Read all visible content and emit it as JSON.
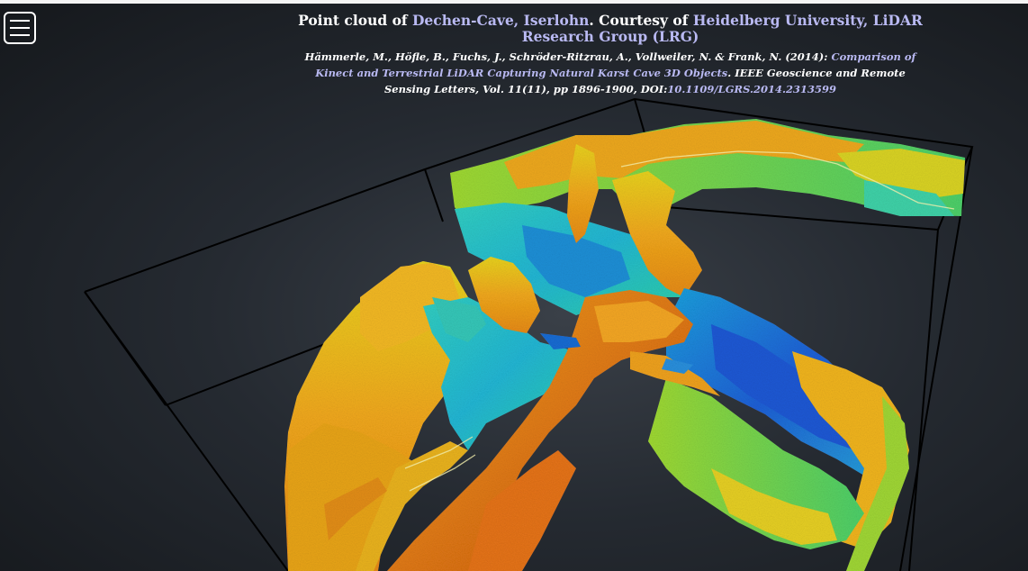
{
  "header": {
    "title_prefix": "Point cloud of ",
    "title_link": "Dechen-Cave, Iserlohn",
    "title_mid": ". Courtesy of ",
    "title_link2": "Heidelberg University, LiDAR Research Group (LRG)",
    "cite_authors": "Hämmerle, M., Höfle, B., Fuchs, J., Schröder-Ritzrau, A., Vollweiler, N. & Frank, N. (2014): ",
    "cite_link": "Comparison of Kinect and Terrestrial LiDAR Capturing Natural Karst Cave 3D Objects",
    "cite_journal": ". IEEE Geoscience and Remote Sensing Letters, Vol. 11(11), pp 1896-1900, DOI:",
    "cite_doi": "10.1109/LGRS.2014.2313599"
  },
  "menu": {
    "icon": "hamburger-menu-icon"
  },
  "viewer": {
    "colormap": [
      "#1f4fd6",
      "#1aa7d8",
      "#2fd3b0",
      "#8bd83a",
      "#e2d21f",
      "#f2a61a",
      "#e07412"
    ]
  }
}
